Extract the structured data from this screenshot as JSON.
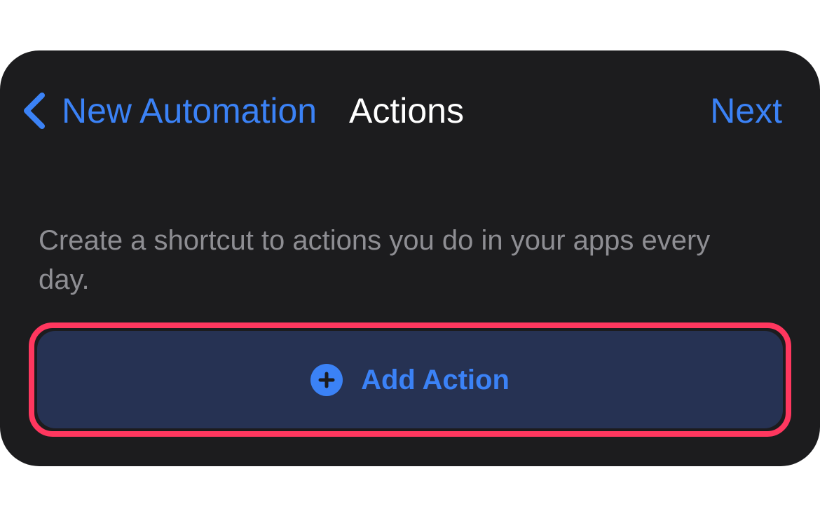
{
  "nav": {
    "back_label": "New Automation",
    "title": "Actions",
    "next_label": "Next"
  },
  "description": "Create a shortcut to actions you do in your apps every day.",
  "add_action": {
    "label": "Add Action",
    "icon": "plus-circle-icon"
  },
  "colors": {
    "background": "#1c1c1e",
    "accent": "#3b82f6",
    "button_fill": "#263253",
    "highlight": "#ff375f",
    "secondary_text": "#8e8e93"
  }
}
